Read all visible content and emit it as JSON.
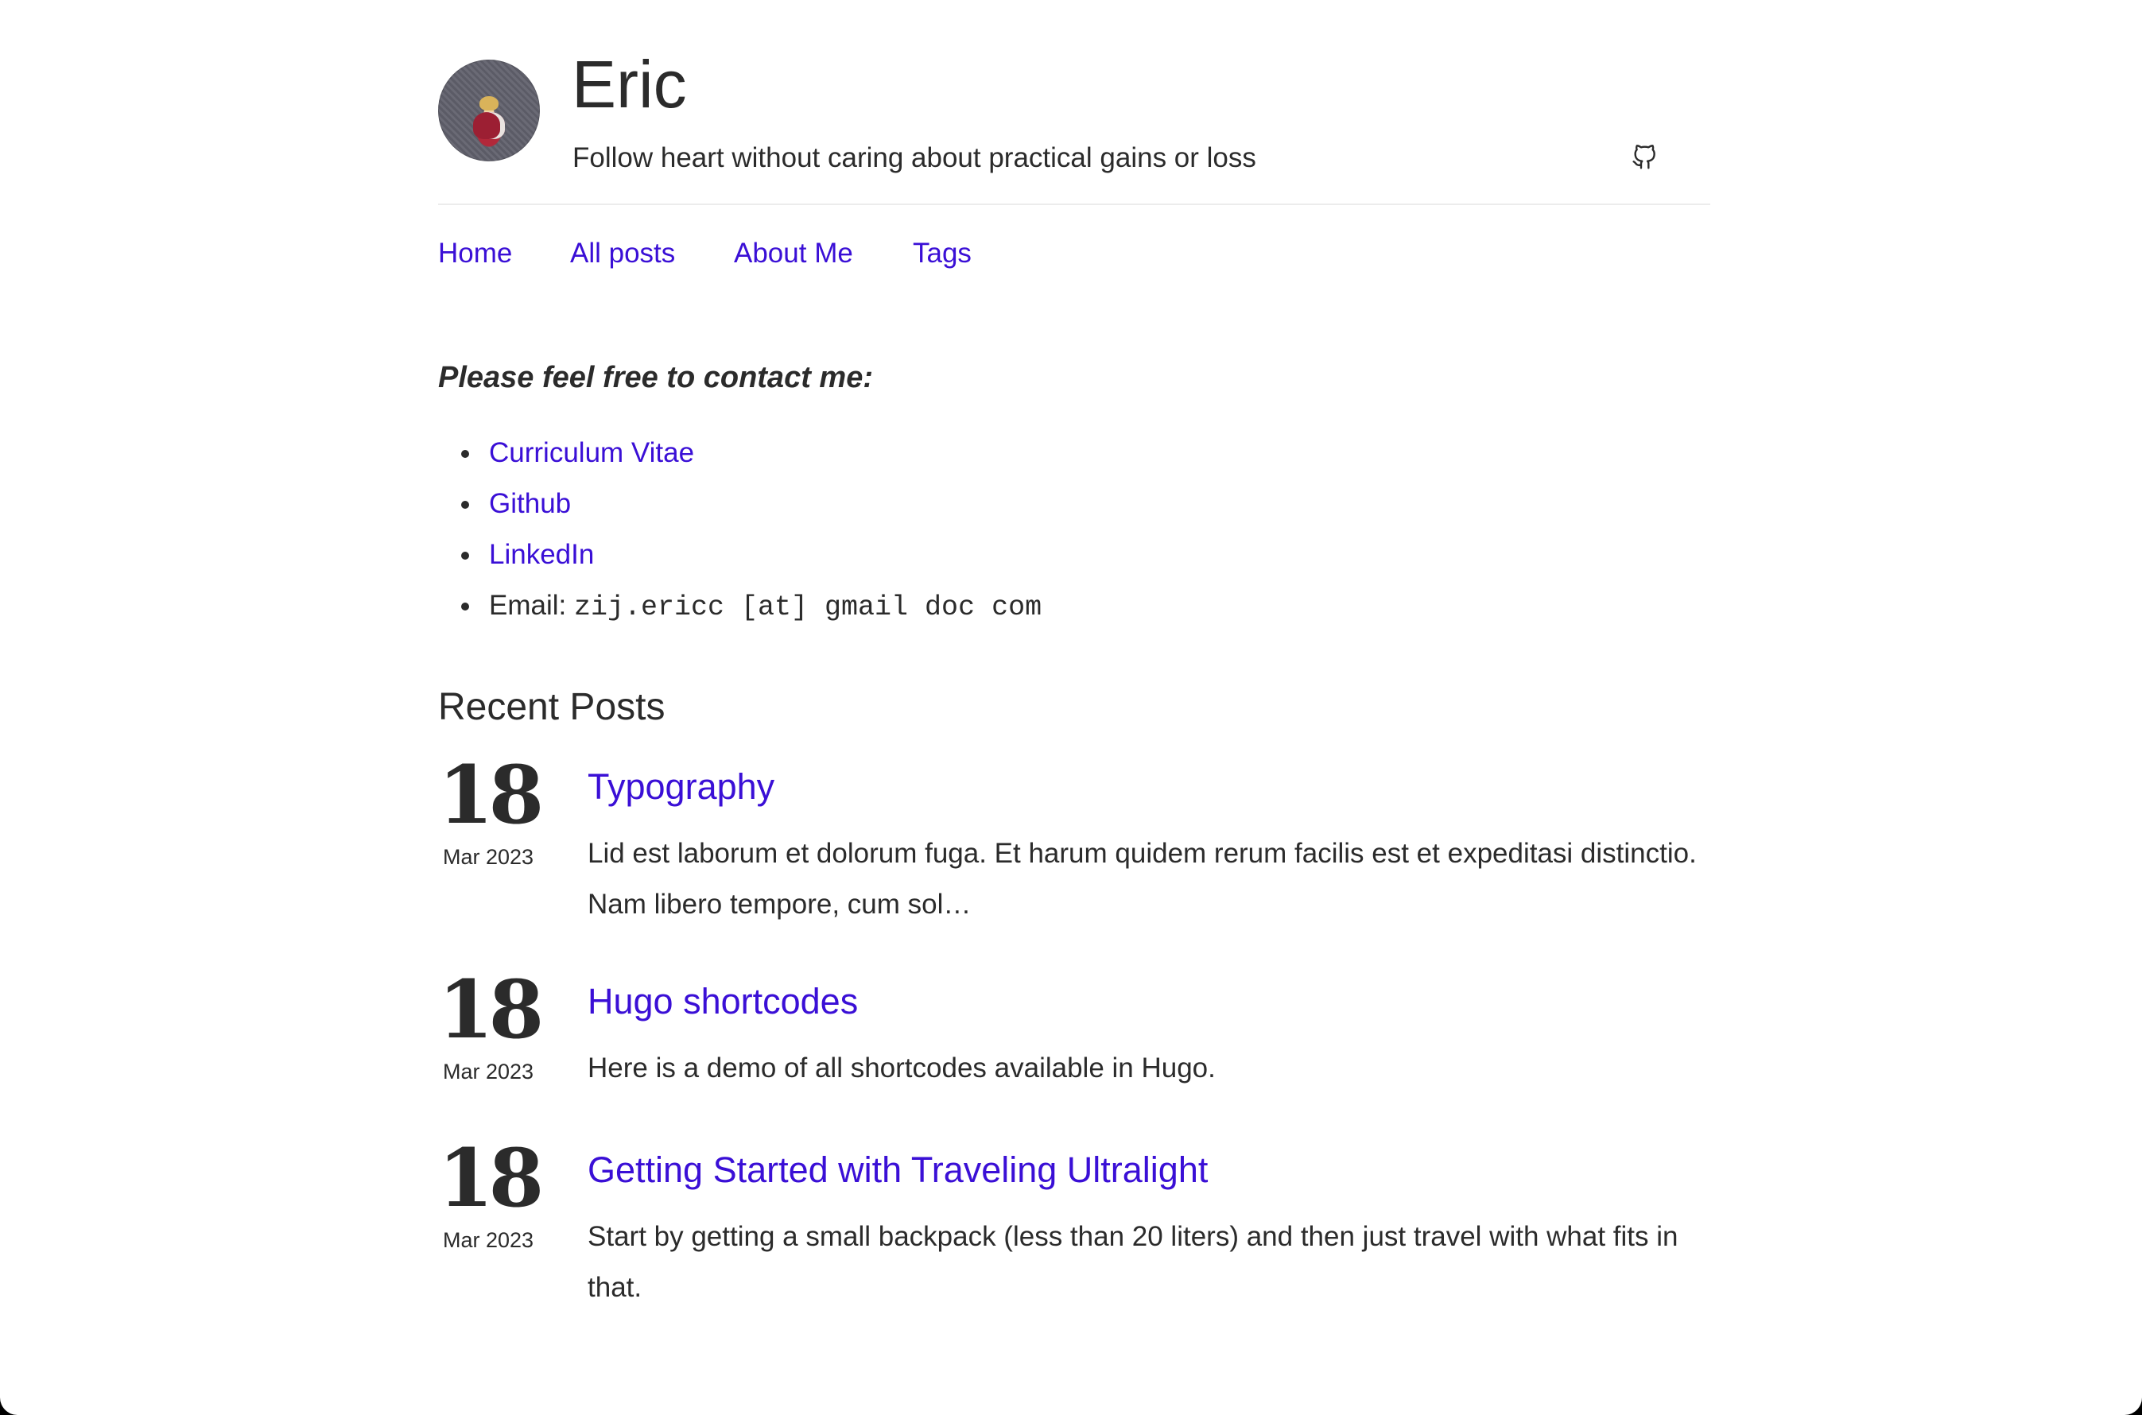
{
  "site": {
    "title": "Eric",
    "tagline": "Follow heart without caring about practical gains or loss",
    "social_icon": "github-icon"
  },
  "nav": {
    "items": [
      {
        "label": "Home"
      },
      {
        "label": "All posts"
      },
      {
        "label": "About Me"
      },
      {
        "label": "Tags"
      }
    ]
  },
  "contact": {
    "heading": "Please feel free to contact me:",
    "items": [
      {
        "label": "Curriculum Vitae"
      },
      {
        "label": "Github"
      },
      {
        "label": "LinkedIn"
      }
    ],
    "email_label": "Email:",
    "email_value": "zij.ericc [at] gmail doc com"
  },
  "recent": {
    "heading": "Recent Posts",
    "posts": [
      {
        "day": "18",
        "month": "Mar 2023",
        "title": "Typography",
        "summary": "Lid est laborum et dolorum fuga. Et harum quidem rerum facilis est et expeditasi distinctio. Nam libero tempore, cum sol…"
      },
      {
        "day": "18",
        "month": "Mar 2023",
        "title": "Hugo shortcodes",
        "summary": "Here is a demo of all shortcodes available in Hugo."
      },
      {
        "day": "18",
        "month": "Mar 2023",
        "title": "Getting Started with Traveling Ultralight",
        "summary": "Start by getting a small backpack (less than 20 liters) and then just travel with what fits in that."
      }
    ]
  },
  "colors": {
    "link": "#3a0fd6",
    "text": "#2b2b2b",
    "background": "#ffffff"
  }
}
